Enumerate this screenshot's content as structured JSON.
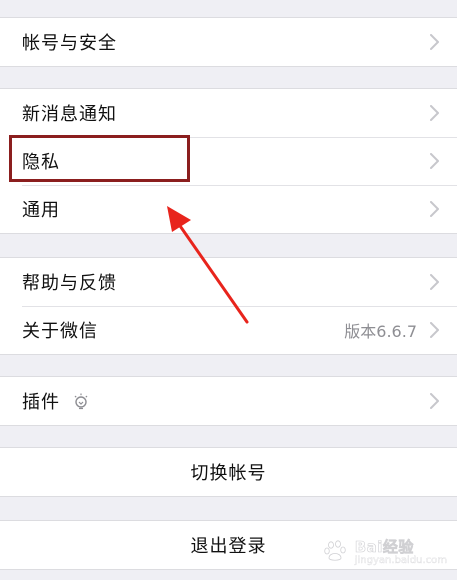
{
  "account_section": {
    "account_security_label": "帐号与安全"
  },
  "settings_section": {
    "notifications_label": "新消息通知",
    "privacy_label": "隐私",
    "general_label": "通用"
  },
  "info_section": {
    "help_label": "帮助与反馈",
    "about_label": "关于微信",
    "version_value": "版本6.6.7"
  },
  "plugins_section": {
    "plugins_label": "插件",
    "plugins_icon": "plugin-bulb-icon"
  },
  "switch_account_label": "切换帐号",
  "logout_label": "退出登录",
  "annotation": {
    "highlight_color": "#8b1e1e",
    "arrow_color": "#e8241c"
  },
  "watermark": {
    "text": "Bai经验",
    "sub": "jingyan.baidu.com"
  },
  "colors": {
    "background": "#efeff4",
    "cell": "#ffffff",
    "text": "#111111",
    "secondary_text": "#8e8e93",
    "chevron": "#c7c7cc"
  }
}
